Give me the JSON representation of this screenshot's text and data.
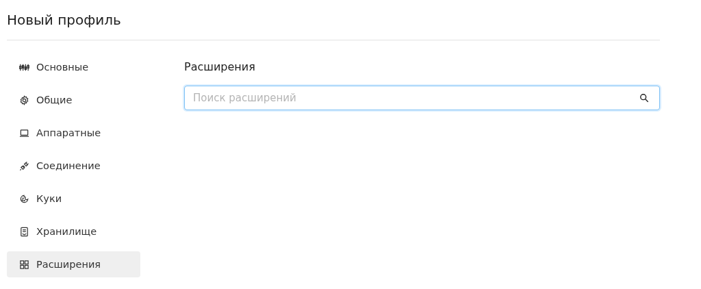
{
  "title": "Новый профиль",
  "sidebar": {
    "items": [
      {
        "label": "Основные",
        "kind": "sliders",
        "selected": false
      },
      {
        "label": "Общие",
        "kind": "gear",
        "selected": false
      },
      {
        "label": "Аппаратные",
        "kind": "laptop",
        "selected": false
      },
      {
        "label": "Соединение",
        "kind": "plug",
        "selected": false
      },
      {
        "label": "Куки",
        "kind": "cookie",
        "selected": false
      },
      {
        "label": "Хранилище",
        "kind": "storage",
        "selected": false
      },
      {
        "label": "Расширения",
        "kind": "grid",
        "selected": true
      }
    ]
  },
  "content": {
    "heading": "Расширения",
    "search": {
      "placeholder": "Поиск расширений",
      "focused": true
    }
  }
}
